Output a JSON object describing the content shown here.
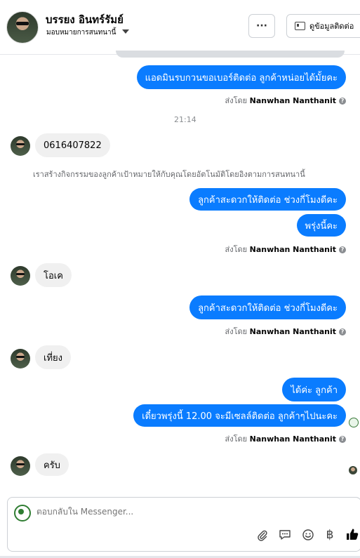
{
  "header": {
    "contact_name": "บรรยง อินทร์รัมย์",
    "assign_label": "มอบหมายการสนทนานี้",
    "more_label": "···",
    "contact_info_label": "ดูข้อมูลติดต่อ"
  },
  "thread": {
    "msg1": "แอดมินรบกวนขอเบอร์ติดต่อ ลูกค้าหน่อยได้มั้ยคะ",
    "sent_by_prefix": "ส่งโดย",
    "agent_name": "Nanwhan Nanthanit",
    "timestamp": "21:14",
    "msg2": "0616407822",
    "system_note": "เราสร้างกิจกรรมของลูกค้าเป้าหมายให้กับคุณโดยอัตโนมัติโดยอิงตามการสนทนานี้",
    "msg3": "ลูกค้าสะดวกให้ติดต่อ ช่วงกี่โมงดีคะ",
    "msg4": "พรุ่งนี้คะ",
    "msg5": "โอเค",
    "msg6": "ลูกค้าสะดวกให้ติดต่อ ช่วงกี่โมงดีคะ",
    "msg7": "เที่ยง",
    "msg8": "ได้ค่ะ ลูกค้า",
    "msg9": "เดี๋ยวพรุ่งนี้ 12.00 จะมีเซลล์ติดต่อ ลูกค้าๆไปนะคะ",
    "msg10": "ครับ"
  },
  "composer": {
    "placeholder": "ตอบกลับใน Messenger..."
  },
  "colors": {
    "outgoing_bubble": "#0a7cff",
    "incoming_bubble": "#f0f0f0",
    "like_icon": "#050505"
  },
  "icons": [
    "card-icon",
    "caret-down-icon",
    "help-icon",
    "attach-icon",
    "saved-replies-icon",
    "emoji-icon",
    "currency-icon",
    "like-icon"
  ]
}
